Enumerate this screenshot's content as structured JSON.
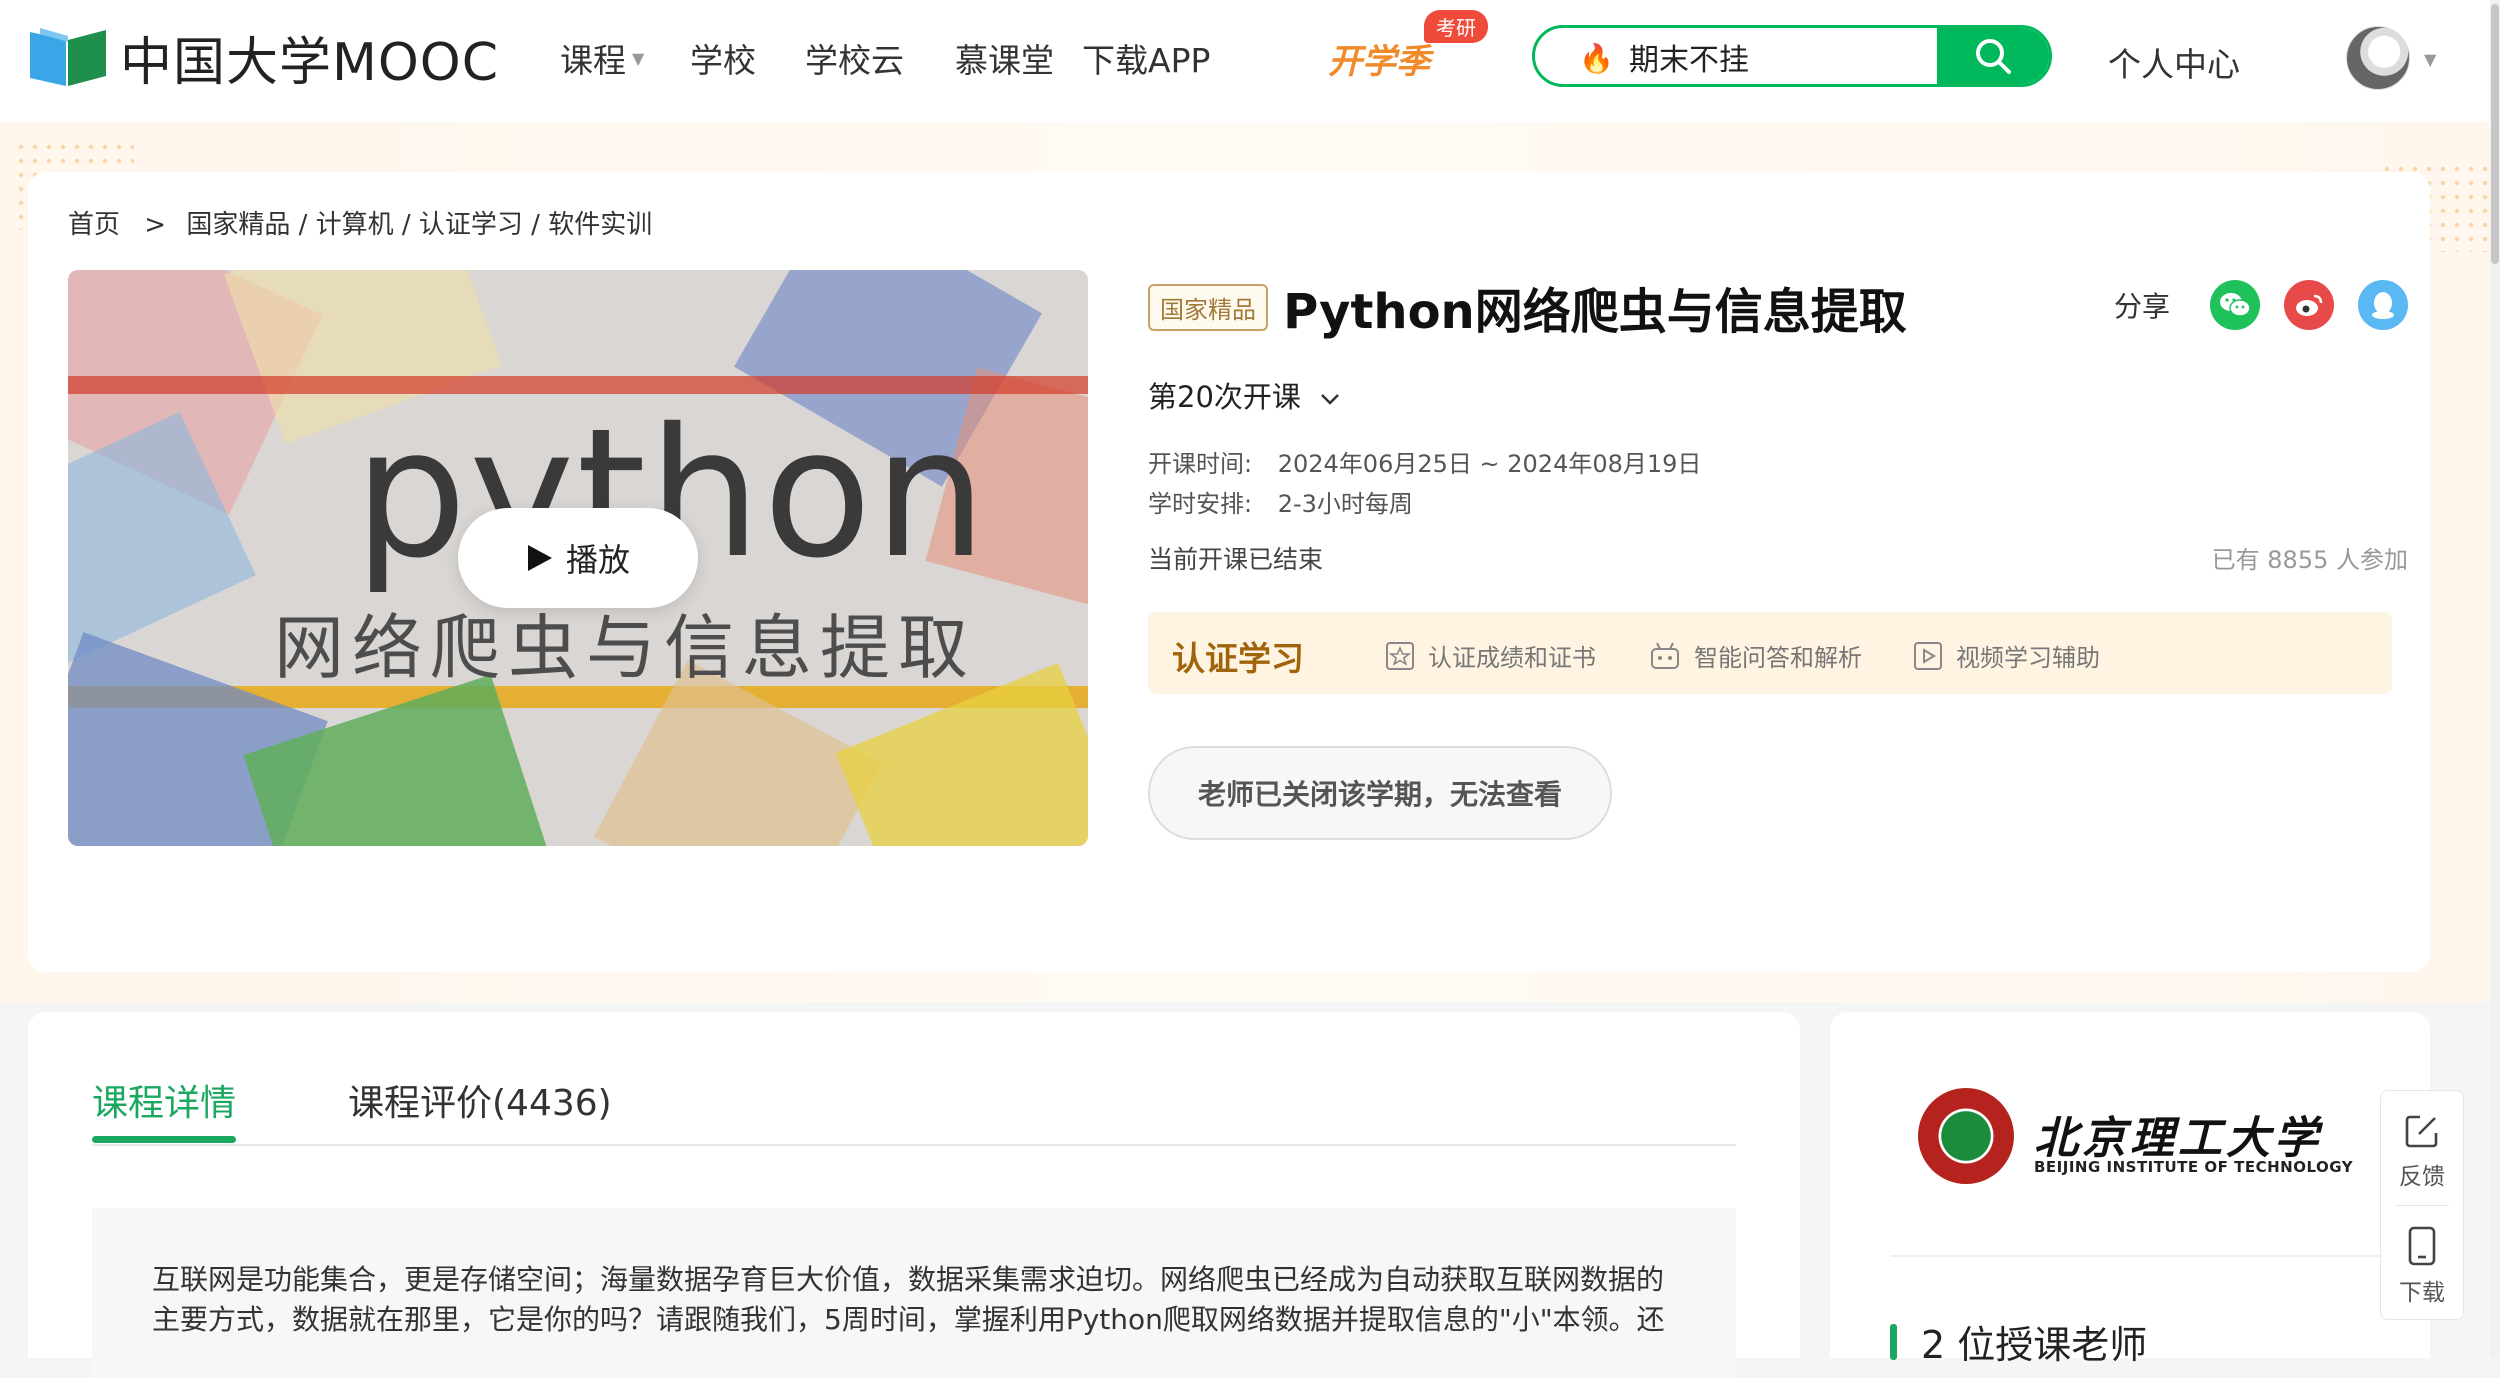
{
  "header": {
    "logo_text": "中国大学MOOC",
    "nav": [
      {
        "label": "课程",
        "has_arrow": true
      },
      {
        "label": "学校"
      },
      {
        "label": "学校云"
      },
      {
        "label": "慕课堂"
      },
      {
        "label": "下载APP"
      }
    ],
    "season_label": "开学季",
    "season_badge": "考研",
    "search_value": "期末不挂",
    "personal_center": "个人中心",
    "colors": {
      "brand_green": "#00b85c",
      "accent_orange": "#f08a2a",
      "badge_red": "#f04a3a"
    }
  },
  "breadcrumb": {
    "home": "首页",
    "separator": ">",
    "path": "国家精品 / 计算机 / 认证学习 / 软件实训"
  },
  "cover": {
    "title": "python",
    "subtitle": "网络爬虫与信息提取",
    "play_label": "播放"
  },
  "course": {
    "tag": "国家精品",
    "title": "Python网络爬虫与信息提取",
    "share_label": "分享",
    "share_icons": [
      "wechat-icon",
      "weibo-icon",
      "qq-icon"
    ],
    "session": "第20次开课",
    "time_label": "开课时间:",
    "time_value": "2024年06月25日 ~ 2024年08月19日",
    "schedule_label": "学时安排:",
    "schedule_value": "2-3小时每周",
    "status": "当前开课已结束",
    "joined": "已有 8855 人参加",
    "cert": {
      "title": "认证学习",
      "items": [
        "认证成绩和证书",
        "智能问答和解析",
        "视频学习辅助"
      ]
    },
    "closed_button": "老师已关闭该学期，无法查看"
  },
  "detail": {
    "tab_details": "课程详情",
    "tab_reviews": "课程评价(4436)",
    "description": "互联网是功能集合，更是存储空间；海量数据孕育巨大价值，数据采集需求迫切。网络爬虫已经成为自动获取互联网数据的主要方式，数据就在那里，它是你的吗？请跟随我们，5周时间，掌握利用Python爬取网络数据并提取信息的\"小\"本领。还"
  },
  "school": {
    "name_cn": "北京理工大学",
    "name_en": "BEIJING INSTITUTE OF TECHNOLOGY",
    "teachers": "2 位授课老师"
  },
  "float": {
    "feedback": "反馈",
    "download": "下载"
  }
}
